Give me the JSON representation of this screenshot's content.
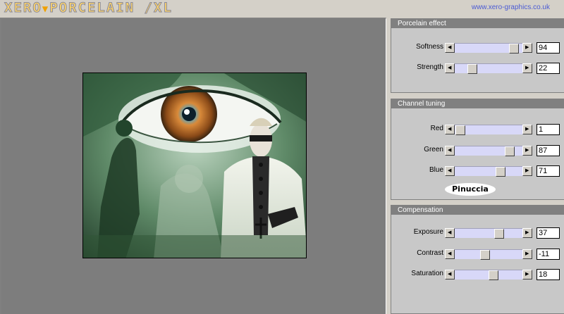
{
  "header": {
    "logo_left": "XERO",
    "logo_sep": "▼",
    "logo_right": "PORCELAIN /XL",
    "url": "www.xero-graphics.co.uk"
  },
  "panels": {
    "porcelain": {
      "title": "Porcelain effect",
      "sliders": [
        {
          "label": "Softness",
          "value": "94",
          "level": 0.94
        },
        {
          "label": "Strength",
          "value": "22",
          "level": 0.22
        }
      ]
    },
    "channel": {
      "title": "Channel tuning",
      "sliders": [
        {
          "label": "Red",
          "value": "1",
          "level": 0.01
        },
        {
          "label": "Green",
          "value": "87",
          "level": 0.87
        },
        {
          "label": "Blue",
          "value": "71",
          "level": 0.71
        }
      ],
      "signature": "Pinuccia"
    },
    "compensation": {
      "title": "Compensation",
      "sliders": [
        {
          "label": "Exposure",
          "value": "37",
          "level": 0.685
        },
        {
          "label": "Contrast",
          "value": "-11",
          "level": 0.445
        },
        {
          "label": "Saturation",
          "value": "18",
          "level": 0.59
        }
      ]
    }
  },
  "colors": {
    "accent_logo": "#ffd56a",
    "url_link": "#4b5bd4",
    "track": "#d8d8f8",
    "panel_title_bg": "#808080"
  }
}
